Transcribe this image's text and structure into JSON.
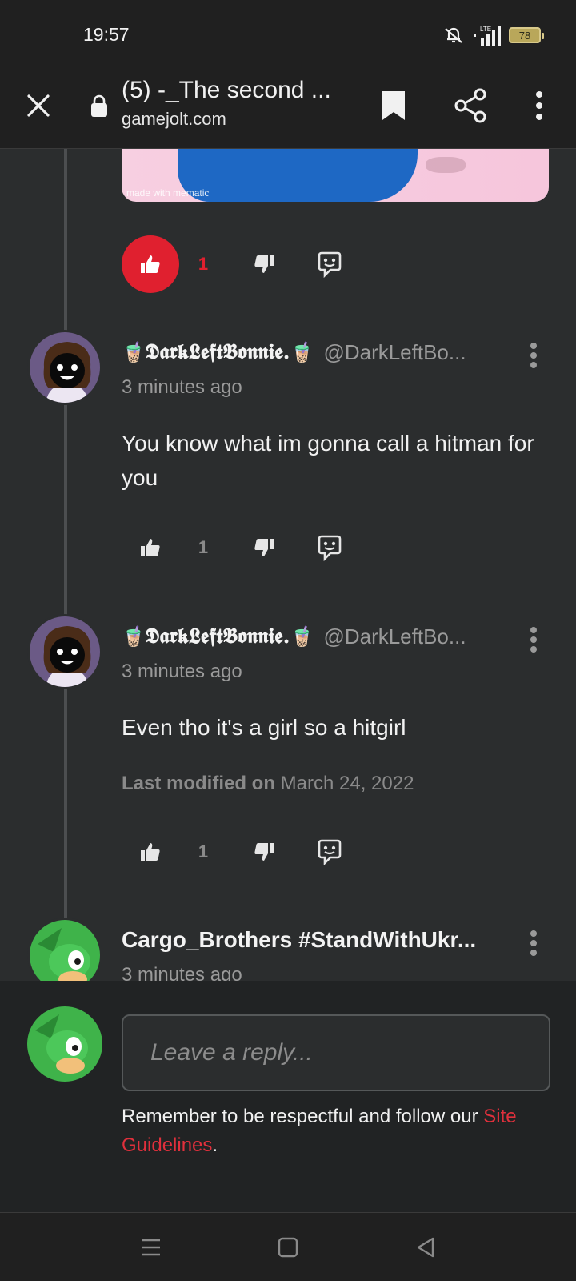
{
  "status_bar": {
    "time": "19:57",
    "battery": "78",
    "network": "LTE"
  },
  "browser": {
    "title": "(5) -_The second ...",
    "url": "gamejolt.com"
  },
  "media": {
    "caption": "made with mematic"
  },
  "top_votes": {
    "like_count": "1"
  },
  "comments": [
    {
      "emoji_left": "🧋",
      "display_name": "𝕯𝖆𝖗𝖐𝕷𝖊𝖋𝖙𝕭𝖔𝖓𝖓𝖎𝖊.",
      "emoji_right": "🧋",
      "username": "@DarkLeftBo...",
      "time": "3 minutes ago",
      "body": "You know what im gonna call a hitman for you",
      "like_count": "1"
    },
    {
      "emoji_left": "🧋",
      "display_name": "𝕯𝖆𝖗𝖐𝕷𝖊𝖋𝖙𝕭𝖔𝖓𝖓𝖎𝖊.",
      "emoji_right": "🧋",
      "username": "@DarkLeftBo...",
      "time": "3 minutes ago",
      "body": "Even tho it's a girl so a hitgirl",
      "modified_label": "Last modified on",
      "modified_date": "March 24, 2022",
      "like_count": "1"
    },
    {
      "display_name": "Cargo_Brothers #StandWithUkr...",
      "time": "3 minutes ago"
    }
  ],
  "reply": {
    "placeholder": "Leave a reply...",
    "guidelines_text": "Remember to be respectful and follow our ",
    "guidelines_link": "Site Guidelines",
    "guidelines_end": "."
  },
  "colors": {
    "accent": "#e0202f",
    "background": "#2b2d2e",
    "bar": "#202020"
  }
}
